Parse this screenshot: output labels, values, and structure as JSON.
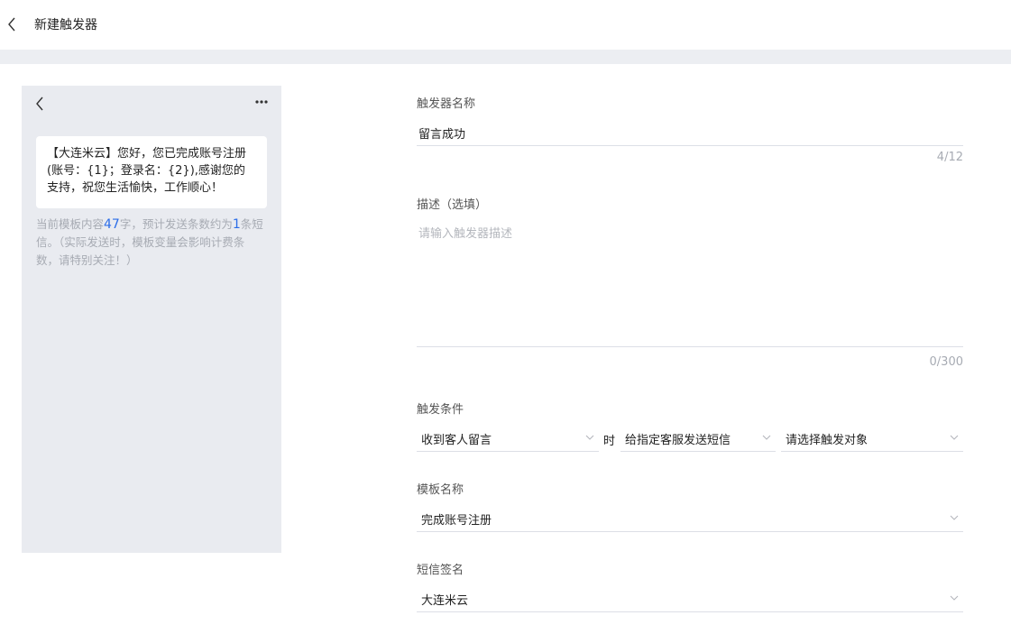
{
  "header": {
    "title": "新建触发器"
  },
  "preview": {
    "message": "【大连米云】您好，您已完成账号注册(账号：{1}；登录名：{2}),感谢您的支持，祝您生活愉快，工作顺心！",
    "tip_prefix": "当前模板内容",
    "char_count": "47",
    "tip_mid": "字，预计发送条数约为",
    "sms_count": "1",
    "tip_suffix": "条短信。（实际发送时，模板变量会影响计费条数，请特别关注！）"
  },
  "form": {
    "name_label": "触发器名称",
    "name_value": "留言成功",
    "name_counter": "4/12",
    "desc_label": "描述（选填）",
    "desc_placeholder": "请输入触发器描述",
    "desc_counter": "0/300",
    "condition_label": "触发条件",
    "condition_event": "收到客人留言",
    "condition_time_word": "时",
    "condition_action": "给指定客服发送短信",
    "condition_target_placeholder": "请选择触发对象",
    "template_label": "模板名称",
    "template_value": "完成账号注册",
    "signature_label": "短信签名",
    "signature_value": "大连米云"
  },
  "icons": {
    "back": "chevron-left-icon",
    "more": "more-dots-icon",
    "dropdown": "chevron-down-icon"
  },
  "colors": {
    "accent": "#2b6de8",
    "preview_bg": "#e9ebf0",
    "band": "#eceef2"
  }
}
